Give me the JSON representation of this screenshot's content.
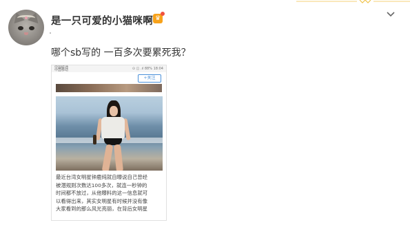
{
  "post": {
    "username": "是一只可爱的小猫咪啊",
    "vip_badge": "vip-crown-icon",
    "text": "哪个sb写的 一百多次要累死我？"
  },
  "screenshot": {
    "status_left": "中国联通\n中国移动",
    "status_right": "⊙ ◫ .ıl 88% 18:04",
    "follow_label": "+关注",
    "article_lines": [
      "最近台湾女明星钟鹿纯就自曝说自己曾经",
      "被潜规则次数达100多次，就连一秒钟的",
      "时间都不放过，从他曝料的这一信息就可",
      "以看得出来，其实女明星有时候并没有像",
      "大家看到的那么风光亮丽，在背后女明星"
    ]
  },
  "colors": {
    "username": "#333333",
    "vip": "#f7a21b",
    "follow": "#4a90d9"
  }
}
